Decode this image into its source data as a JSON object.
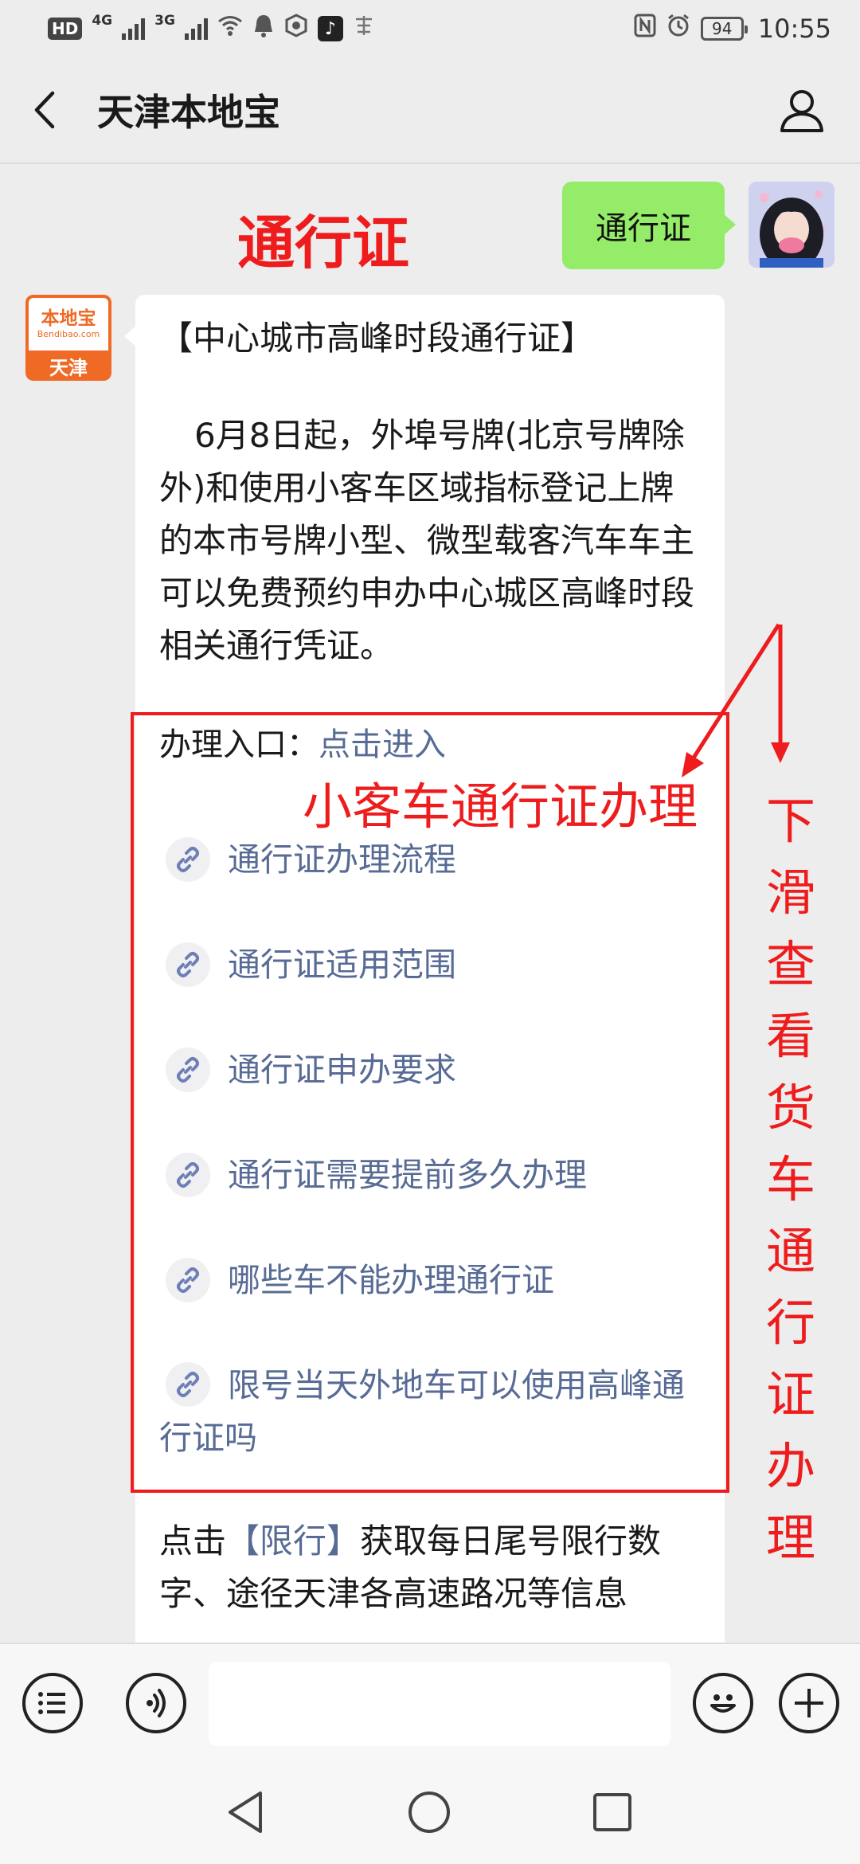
{
  "status_bar": {
    "hd": "HD",
    "net1": "4G",
    "net2": "3G",
    "battery": "94",
    "time": "10:55"
  },
  "header": {
    "title": "天津本地宝",
    "back_icon": "chevron-left-icon",
    "profile_icon": "person-icon"
  },
  "overlay": {
    "title": "通行证",
    "car_label": "小客车通行证办理",
    "truck_label": "下滑查看货车通行证办理"
  },
  "my_message": {
    "text": "通行证"
  },
  "sys_avatar": {
    "logo_text": "本地宝",
    "logo_en": "Bendibao.com",
    "city": "天津"
  },
  "message": {
    "heading": "【中心城市高峰时段通行证】",
    "body": "6月8日起，外埠号牌(北京号牌除外)和使用小客车区域指标登记上牌的本市号牌小型、微型载客汽车车主可以免费预约申办中心城区高峰时段相关通行凭证。",
    "entry_label": "办理入口：",
    "entry_link": "点击进入",
    "links": [
      "通行证办理流程",
      "通行证适用范围",
      "通行证申办要求",
      "通行证需要提前多久办理",
      "哪些车不能办理通行证",
      "限号当天外地车可以使用高峰通行证吗"
    ],
    "limit_prefix": "点击",
    "limit_link": "【限行】",
    "limit_suffix": "获取每日尾号限行数字、途径天津各高速路况等信息"
  },
  "input_bar": {
    "menu_icon": "menu-list-icon",
    "voice_icon": "voice-icon",
    "emoji_icon": "emoji-icon",
    "add_icon": "add-icon"
  },
  "nav_bar": {
    "back_icon": "nav-back-icon",
    "home_icon": "nav-home-icon",
    "recent_icon": "nav-recent-icon"
  },
  "colors": {
    "accent_red": "#ee1c1c",
    "link_blue": "#576b95",
    "bubble_green": "#95ec69",
    "brand_orange": "#ee6a25"
  }
}
